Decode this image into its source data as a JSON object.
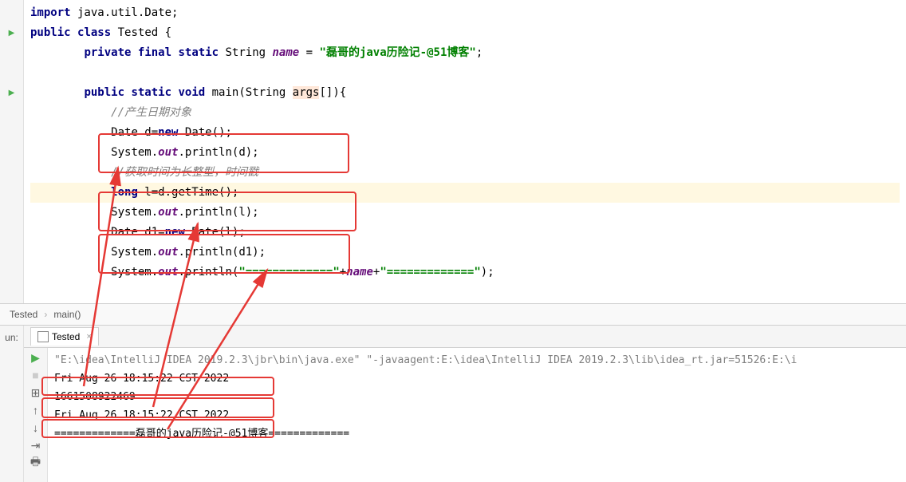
{
  "gutter_lines": [
    "",
    "",
    "",
    "",
    "",
    "",
    "",
    "",
    "",
    "",
    "",
    "",
    "",
    "",
    ""
  ],
  "run_markers": [
    1,
    4
  ],
  "code": {
    "l1": {
      "import": "import",
      "pkg": " java.util.Date;"
    },
    "l2": {
      "public": "public",
      "class": "class",
      "name": " Tested {"
    },
    "l3": {
      "indent": "        ",
      "private": "private",
      "final": "final",
      "static": "static",
      "type": " String ",
      "field": "name",
      "eq": " = ",
      "str": "\"磊哥的java历险记-@51博客\"",
      "semi": ";"
    },
    "l4": "",
    "l5": {
      "indent": "        ",
      "public": "public",
      "static": "static",
      "void": "void",
      "main": " main(String ",
      "args": "args",
      "rest": "[]){"
    },
    "l6": {
      "indent": "            ",
      "comment": "//产生日期对象"
    },
    "l7": {
      "indent": "            ",
      "text1": "Date d=",
      "new": "new",
      "text2": " Date();"
    },
    "l8": {
      "indent": "            ",
      "text1": "System.",
      "out": "out",
      "text2": ".println(d);"
    },
    "l9": {
      "indent": "            ",
      "comment": "//获取时间为长整型，时间戳"
    },
    "l10": {
      "indent": "            ",
      "long": "long",
      "text": " l=d.getTime();"
    },
    "l11": {
      "indent": "            ",
      "text1": "System.",
      "out": "out",
      "text2": ".println(l);"
    },
    "l12": {
      "indent": "            ",
      "text1": "Date d1=",
      "new": "new",
      "text2": " Date(l);"
    },
    "l13": {
      "indent": "            ",
      "text1": "System.",
      "out": "out",
      "text2": ".println(d1);"
    },
    "l14": {
      "indent": "            ",
      "text1": "System.",
      "out": "out",
      "text2": ".println(",
      "str1": "\"=============\"",
      "plus1": "+",
      "name": "name",
      "plus2": "+",
      "str2": "\"=============\"",
      "close": ");"
    }
  },
  "breadcrumb": {
    "class": "Tested",
    "method": "main()"
  },
  "run": {
    "label": "un:",
    "tab": "Tested",
    "console": {
      "cmd": "\"E:\\idea\\IntelliJ IDEA 2019.2.3\\jbr\\bin\\java.exe\" \"-javaagent:E:\\idea\\IntelliJ IDEA 2019.2.3\\lib\\idea_rt.jar=51526:E:\\i",
      "out1": "Fri Aug 26 18:15:22 CST 2022",
      "out2": "1661508922469",
      "out3": "Fri Aug 26 18:15:22 CST 2022",
      "out4": "=============磊哥的java历险记-@51博客============="
    }
  }
}
